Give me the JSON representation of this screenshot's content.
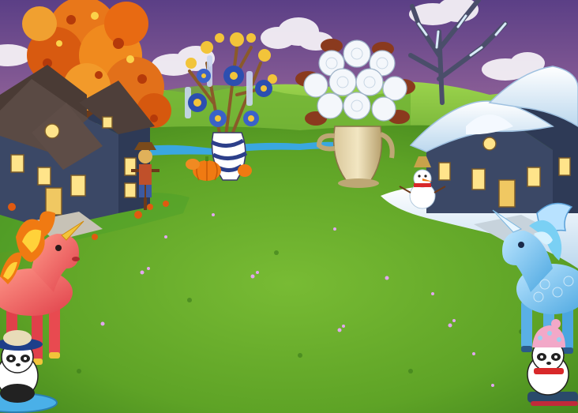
{
  "scene": {
    "theme": "farm-seasonal-showcase",
    "colors": {
      "sky_top": "#5b3f86",
      "sky_mid": "#b57aa5",
      "sky_horizon": "#f3a982",
      "grass_light": "#7fc43a",
      "grass_dark": "#3f8a1e",
      "snow": "#e8f2fb",
      "autumn_orange": "#f07a12",
      "house_slate": "#3b4866",
      "window_glow": "#ffe48a"
    },
    "icons": [
      "autumn-tree-icon",
      "autumn-house-icon",
      "flower-vase-tree-icon",
      "pumpkin-icon",
      "scarecrow-icon",
      "teapot-white-roses-icon",
      "frozen-tree-icon",
      "snowy-house-icon",
      "snowman-icon",
      "fire-unicorn-icon",
      "ice-unicorn-icon",
      "panda-surfer-icon",
      "panda-sled-icon"
    ]
  }
}
